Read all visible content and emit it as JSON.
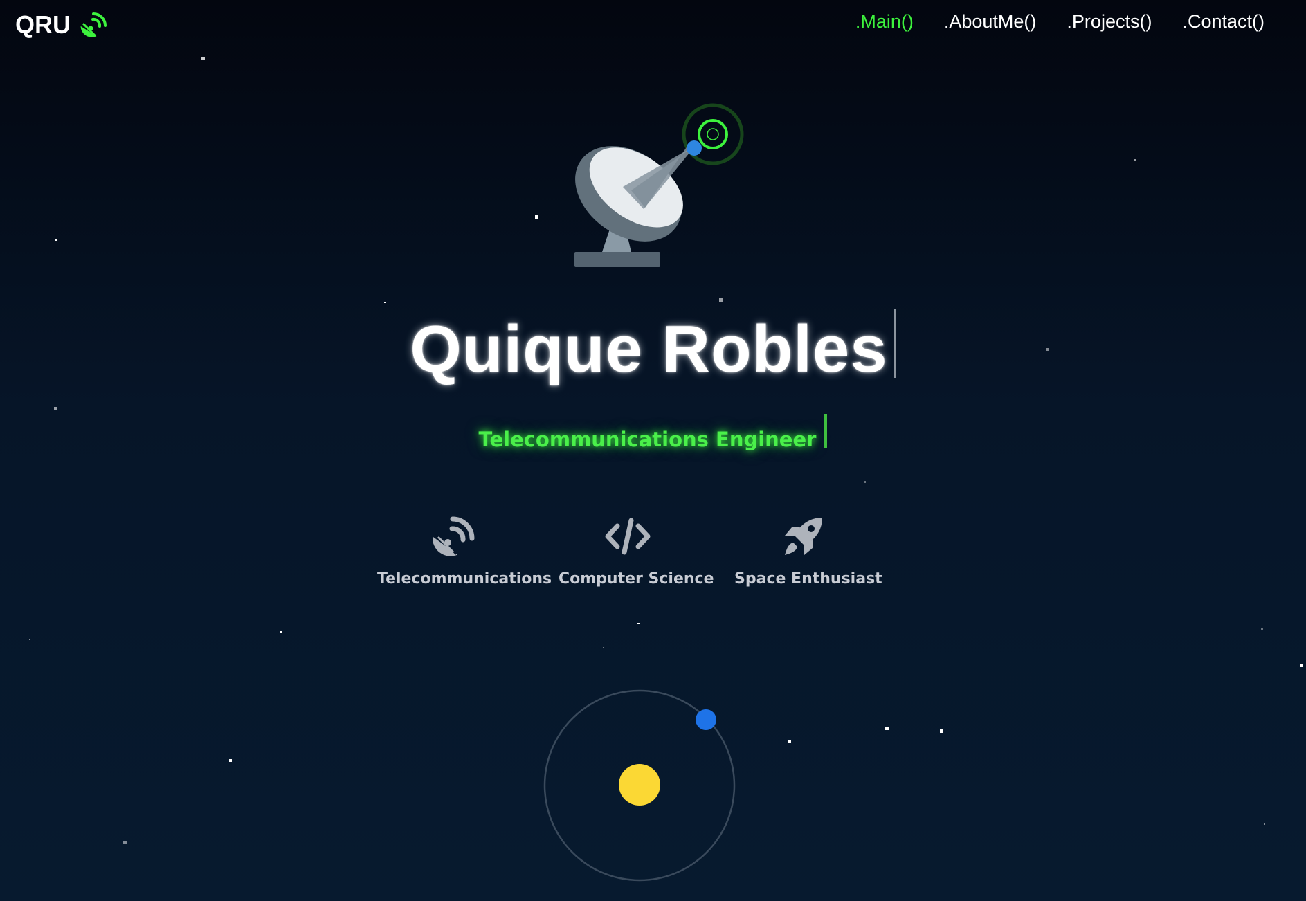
{
  "brand": {
    "logo_text": "QRU",
    "icon": "satellite-dish-icon",
    "icon_color": "#3df23d"
  },
  "nav": {
    "items": [
      {
        "label": ".Main()",
        "active": true
      },
      {
        "label": ".AboutMe()",
        "active": false
      },
      {
        "label": ".Projects()",
        "active": false
      },
      {
        "label": ".Contact()",
        "active": false
      }
    ],
    "active_color": "#3df23d"
  },
  "hero": {
    "illustration": "satellite-dish-icon",
    "title": "Quique Robles",
    "subtitle": "Telecommunications Engineer",
    "subtitle_color": "#4af04a"
  },
  "features": [
    {
      "icon": "satellite-dish-icon",
      "label": "Telecommunications"
    },
    {
      "icon": "code-icon",
      "label": "Computer Science"
    },
    {
      "icon": "rocket-icon",
      "label": "Space Enthusiast"
    }
  ],
  "orbit": {
    "sun_color": "#fbd834",
    "planet_color": "#1e73e8",
    "ring_color": "#3a4a5c"
  },
  "colors": {
    "background_top": "#03060f",
    "background_bottom": "#071a2f"
  }
}
